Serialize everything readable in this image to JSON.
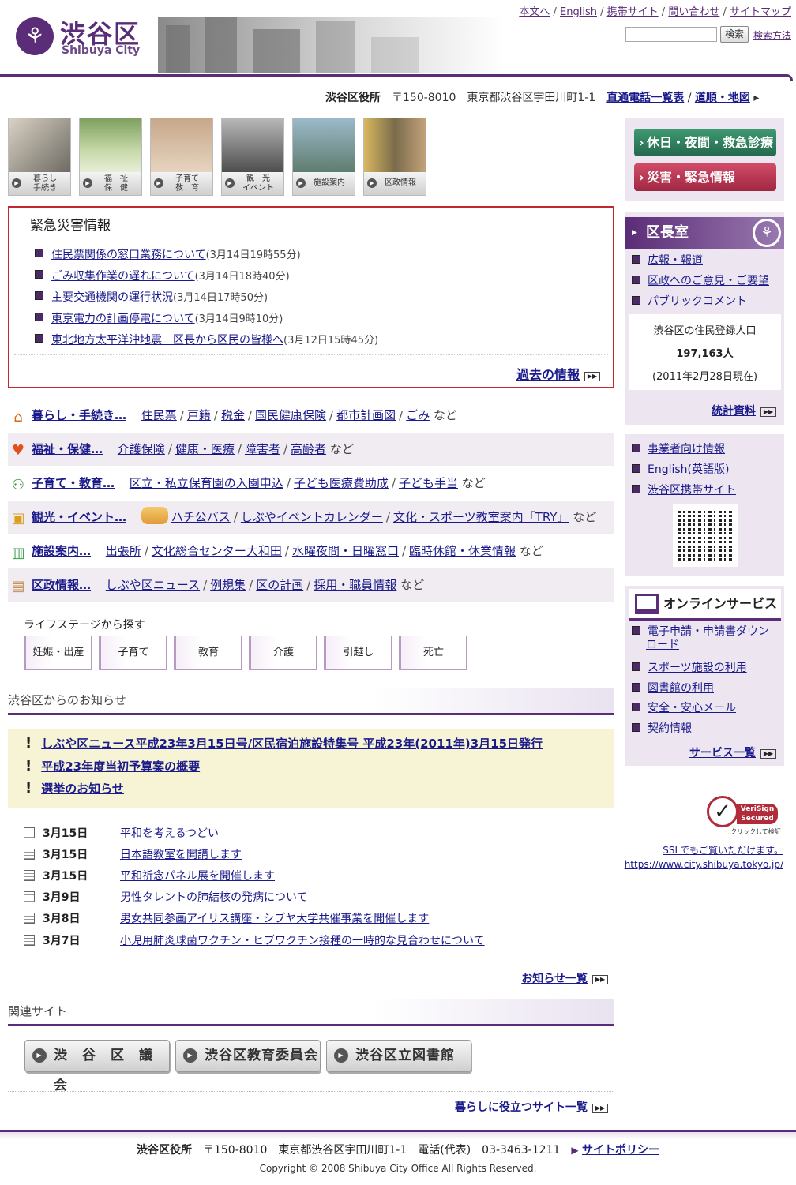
{
  "header": {
    "logo_jp": "渋谷区",
    "logo_en": "Shibuya City",
    "top_links": [
      "本文へ",
      "English",
      "携帯サイト",
      "問い合わせ",
      "サイトマップ"
    ],
    "search_button": "検索",
    "search_help": "検索方法",
    "search_value": ""
  },
  "address_bar": {
    "office": "渋谷区役所",
    "address": "〒150-8010　東京都渋谷区宇田川町1-1",
    "link1": "直通電話一覧表",
    "link2": "道順・地図"
  },
  "categories": [
    {
      "label": "暮らし\n手続き"
    },
    {
      "label": "福　祉\n保　健"
    },
    {
      "label": "子育て\n教　育"
    },
    {
      "label": "観　光\nイベント"
    },
    {
      "label": "施設案内"
    },
    {
      "label": "区政情報"
    }
  ],
  "emergency": {
    "title": "緊急災害情報",
    "items": [
      {
        "text": "住民票関係の窓口業務について",
        "time": "(3月14日19時55分)"
      },
      {
        "text": "ごみ収集作業の遅れについて",
        "time": "(3月14日18時40分)"
      },
      {
        "text": "主要交通機関の運行状況",
        "time": "(3月14日17時50分)"
      },
      {
        "text": "東京電力の計画停電について",
        "time": "(3月14日9時10分)"
      },
      {
        "text": "東北地方太平洋沖地震　区長から区民の皆様へ",
        "time": "(3月12日15時45分)"
      }
    ],
    "past": "過去の情報"
  },
  "rows": [
    {
      "head": "暮らし・手続き…",
      "links": [
        "住民票",
        "戸籍",
        "税金",
        "国民健康保険",
        "都市計画図",
        "ごみ"
      ],
      "tail": "など"
    },
    {
      "head": "福祉・保健…",
      "links": [
        "介護保険",
        "健康・医療",
        "障害者",
        "高齢者"
      ],
      "tail": "など"
    },
    {
      "head": "子育て・教育…",
      "links": [
        "区立・私立保育園の入園申込",
        "子ども医療費助成",
        "子ども手当"
      ],
      "tail": "など"
    },
    {
      "head": "観光・イベント…",
      "links": [
        "ハチ公バス",
        "しぶやイベントカレンダー",
        "文化・スポーツ教室案内「TRY」"
      ],
      "tail": "など"
    },
    {
      "head": "施設案内…",
      "links": [
        "出張所",
        "文化総合センター大和田",
        "水曜夜間・日曜窓口",
        "臨時休館・休業情報"
      ],
      "tail": "など"
    },
    {
      "head": "区政情報…",
      "links": [
        "しぶや区ニュース",
        "例規集",
        "区の計画",
        "採用・職員情報"
      ],
      "tail": "など"
    }
  ],
  "life_stage": {
    "title": "ライフステージから探す",
    "items": [
      "妊娠・出産",
      "子育て",
      "教育",
      "介護",
      "引越し",
      "死亡"
    ]
  },
  "notices": {
    "title": "渋谷区からのお知らせ",
    "highlights": [
      "しぶや区ニュース平成23年3月15日号/区民宿泊施設特集号 平成23年(2011年)3月15日発行",
      "平成23年度当初予算案の概要",
      "選挙のお知らせ"
    ],
    "items": [
      {
        "date": "3月15日",
        "text": "平和を考えるつどい"
      },
      {
        "date": "3月15日",
        "text": "日本語教室を開講します"
      },
      {
        "date": "3月15日",
        "text": "平和祈念パネル展を開催します"
      },
      {
        "date": "3月9日",
        "text": "男性タレントの肺結核の発病について"
      },
      {
        "date": "3月8日",
        "text": "男女共同参画アイリス講座・シブヤ大学共催事業を開催します"
      },
      {
        "date": "3月7日",
        "text": "小児用肺炎球菌ワクチン・ヒブワクチン接種の一時的な見合わせについて"
      }
    ],
    "more": "お知らせ一覧"
  },
  "related": {
    "title": "関連サイト",
    "buttons": [
      "渋　谷　区　議　会",
      "渋谷区教育委員会",
      "渋谷区立図書館"
    ],
    "more": "暮らしに役立つサイト一覧"
  },
  "sidebar": {
    "holiday_btn": "休日・夜間・救急診療",
    "disaster_btn": "災害・緊急情報",
    "mayor_title": "区長室",
    "mayor_links": [
      "広報・報道",
      "区政へのご意見・ご要望",
      "パブリックコメント"
    ],
    "pop_label": "渋谷区の住民登録人口",
    "pop_value": "197,163人",
    "pop_date": "(2011年2月28日現在)",
    "stats_link": "統計資料",
    "misc_links": [
      "事業者向け情報",
      "English(英語版)",
      "渋谷区携帯サイト"
    ],
    "online_title": "オンラインサービス",
    "online_links": [
      "電子申請・申請書ダウンロード",
      "スポーツ施設の利用",
      "図書館の利用",
      "安全・安心メール",
      "契約情報"
    ],
    "service_more": "サービス一覧",
    "verisign_a": "VeriSign",
    "verisign_b": "Secured",
    "verisign_caption": "クリックして検証",
    "ssl_text": "SSLでもご覧いただけます。",
    "ssl_url": "https://www.city.shibuya.tokyo.jp/"
  },
  "footer": {
    "office": "渋谷区役所",
    "address": "〒150-8010　東京都渋谷区宇田川町1-1　電話(代表)　03-3463-1211",
    "policy": "サイトポリシー",
    "copyright": "Copyright © 2008 Shibuya City Office All Rights Reserved."
  },
  "colors": {
    "brand": "#5b2c77",
    "alert": "#c0282d",
    "holiday_btn": "#2f7a5b",
    "disaster_btn": "#b8334f"
  }
}
